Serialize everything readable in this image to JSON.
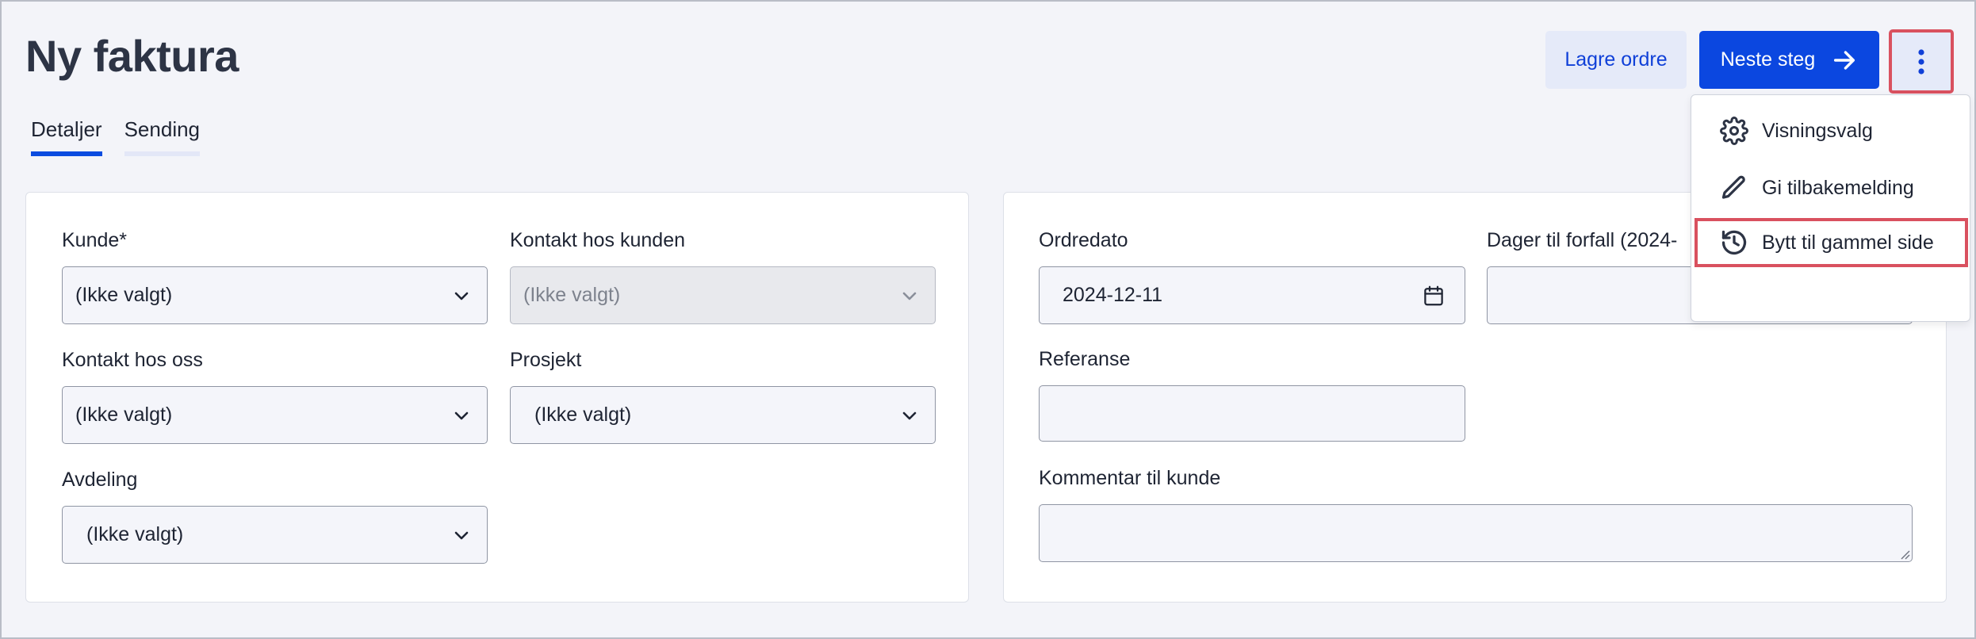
{
  "header": {
    "title": "Ny faktura"
  },
  "tabs": [
    {
      "label": "Detaljer",
      "active": true
    },
    {
      "label": "Sending",
      "active": false
    }
  ],
  "actions": {
    "save_label": "Lagre ordre",
    "next_label": "Neste steg",
    "more_icon": "kebab-vertical-icon"
  },
  "menu": {
    "items": [
      {
        "label": "Visningsvalg",
        "icon": "gear-icon"
      },
      {
        "label": "Gi tilbakemelding",
        "icon": "pencil-icon"
      },
      {
        "label": "Bytt til gammel side",
        "icon": "history-icon"
      }
    ]
  },
  "left_panel": {
    "customer_label": "Kunde*",
    "customer_value": "(Ikke valgt)",
    "customer_contact_label": "Kontakt hos kunden",
    "customer_contact_value": "(Ikke valgt)",
    "our_contact_label": "Kontakt hos oss",
    "our_contact_value": "(Ikke valgt)",
    "project_label": "Prosjekt",
    "project_value": "(Ikke valgt)",
    "department_label": "Avdeling",
    "department_value": "(Ikke valgt)"
  },
  "right_panel": {
    "order_date_label": "Ordredato",
    "order_date_value": "2024-12-11",
    "due_days_label": "Dager til forfall (2024-",
    "due_days_value": "",
    "reference_label": "Referanse",
    "reference_value": "",
    "comment_label": "Kommentar til kunde",
    "comment_value": ""
  },
  "colors": {
    "accent": "#0b47e0",
    "highlight_outline": "#d9515f",
    "background": "#f3f4f9"
  }
}
